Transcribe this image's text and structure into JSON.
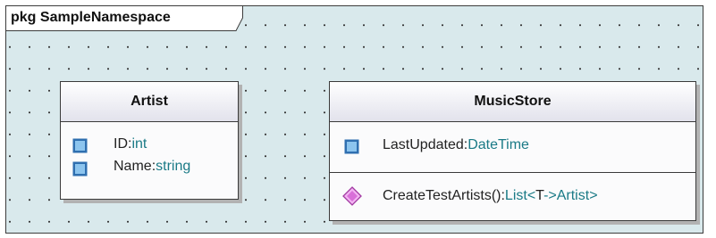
{
  "package": {
    "keyword": "pkg",
    "name": "SampleNamespace"
  },
  "classes": {
    "artist": {
      "name": "Artist",
      "attributes": [
        {
          "name": "ID",
          "type": "int",
          "icon": "attribute-icon"
        },
        {
          "name": "Name",
          "type": "string",
          "icon": "attribute-icon"
        }
      ]
    },
    "musicstore": {
      "name": "MusicStore",
      "attributes": [
        {
          "name": "LastUpdated",
          "type": "DateTime",
          "icon": "attribute-icon"
        }
      ],
      "operations": [
        {
          "name": "CreateTestArtists",
          "params": "()",
          "colon": ":",
          "return_type": "List",
          "generic_open": "<",
          "generic_param": "T",
          "arrow": "->",
          "generic_arg": "Artist",
          "generic_close": ">",
          "icon": "operation-icon"
        }
      ]
    }
  },
  "colors": {
    "canvas": "#d9e9ec",
    "type_text": "#1a7a86",
    "attribute_icon": "#5a9fd4",
    "operation_icon": "#c95ac9"
  }
}
